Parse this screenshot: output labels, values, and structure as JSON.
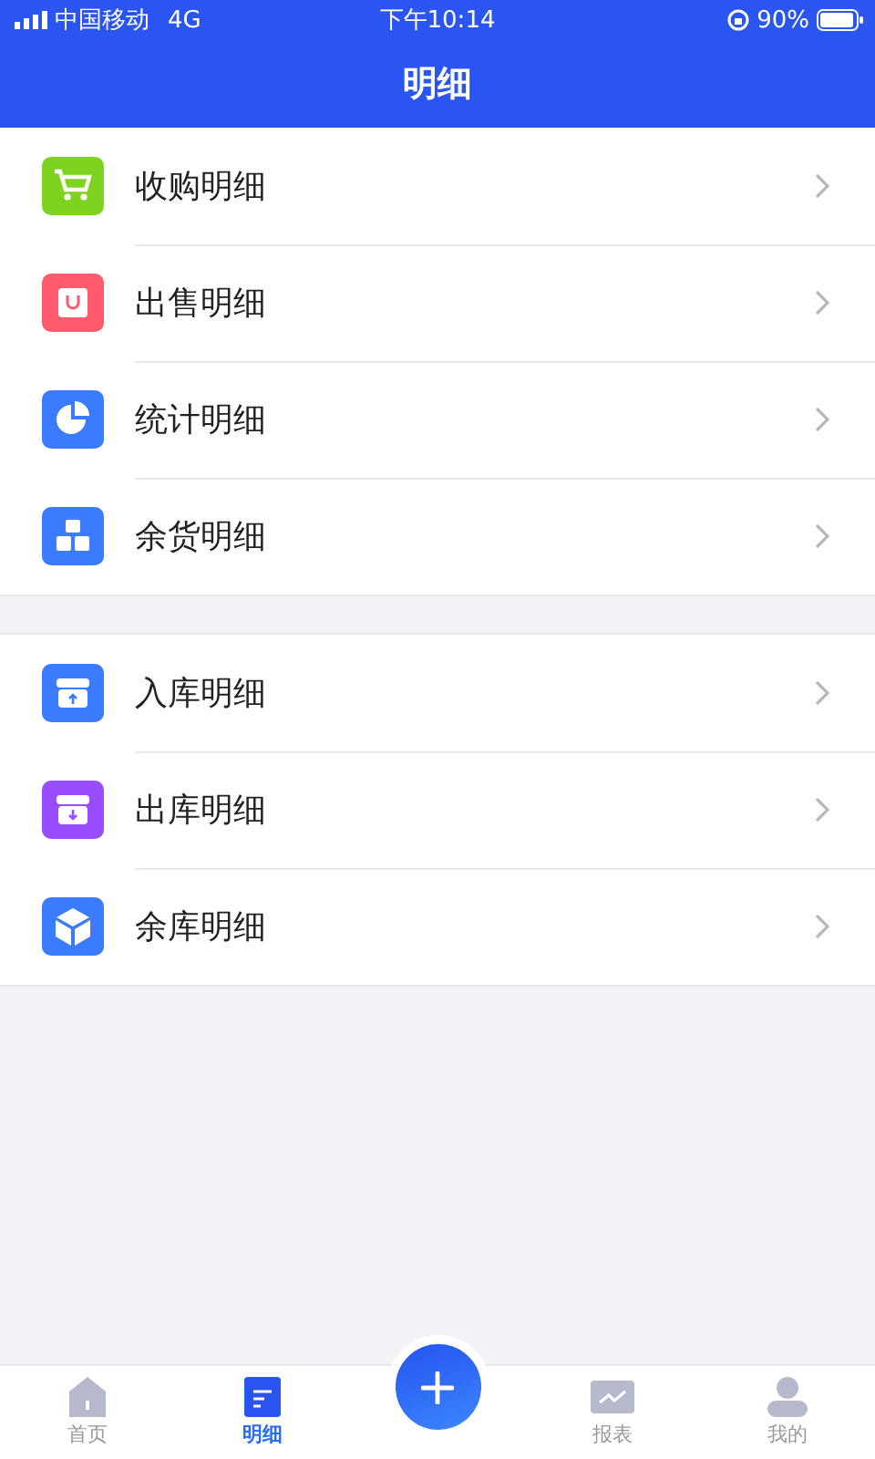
{
  "status_bar": {
    "carrier": "中国移动",
    "network": "4G",
    "time": "下午10:14",
    "battery": "90%"
  },
  "header": {
    "title": "明细"
  },
  "groups": [
    {
      "items": [
        {
          "label": "收购明细",
          "color": "#7ed321"
        },
        {
          "label": "出售明细",
          "color": "#ff5a6e"
        },
        {
          "label": "统计明细",
          "color": "#3b7bff"
        },
        {
          "label": "余货明细",
          "color": "#3b7bff"
        }
      ]
    },
    {
      "items": [
        {
          "label": "入库明细",
          "color": "#3b7bff"
        },
        {
          "label": "出库明细",
          "color": "#9a4dff"
        },
        {
          "label": "余库明细",
          "color": "#3b7bff"
        }
      ]
    }
  ],
  "tabs": [
    {
      "label": "首页",
      "selected": false
    },
    {
      "label": "明细",
      "selected": true
    },
    {
      "label": "报表",
      "selected": false
    },
    {
      "label": "我的",
      "selected": false
    }
  ]
}
